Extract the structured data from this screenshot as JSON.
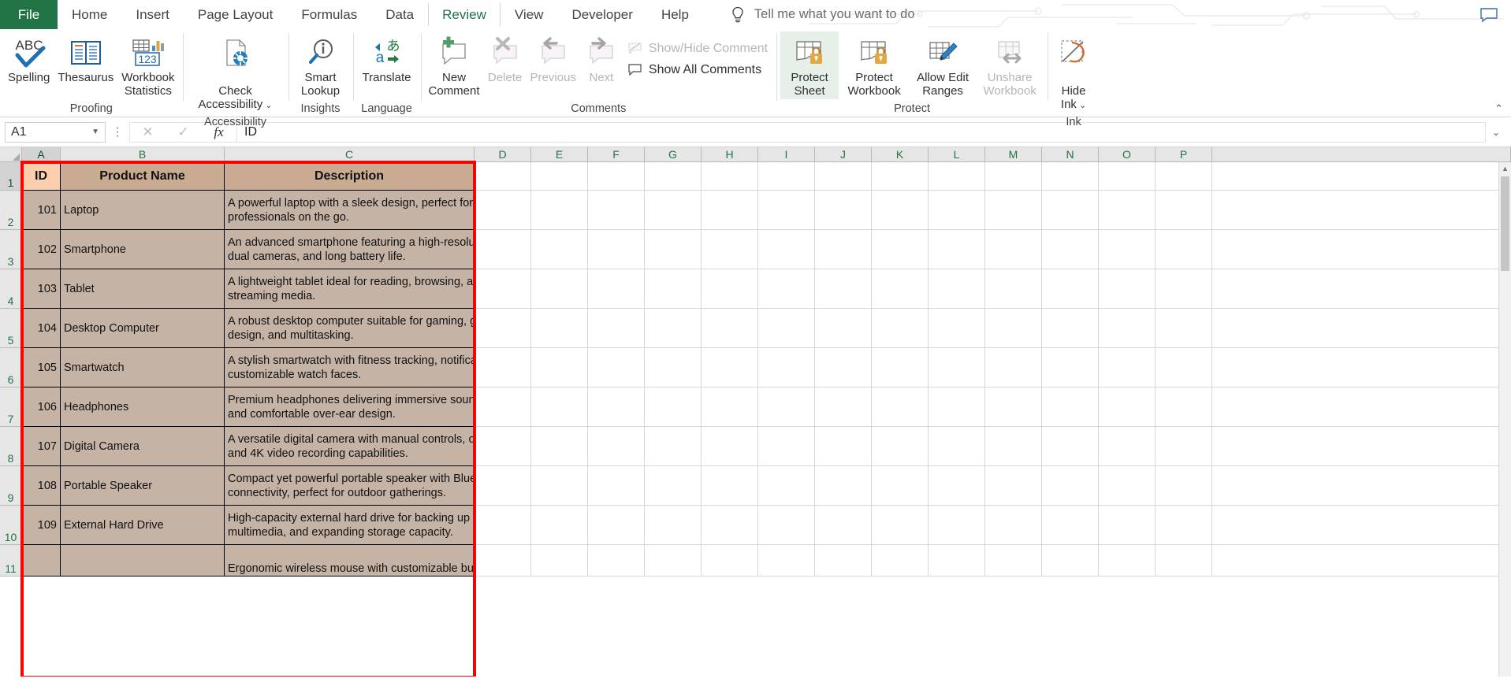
{
  "tabs": [
    {
      "label": "File",
      "active": false,
      "is_file": true
    },
    {
      "label": "Home",
      "active": false
    },
    {
      "label": "Insert",
      "active": false
    },
    {
      "label": "Page Layout",
      "active": false
    },
    {
      "label": "Formulas",
      "active": false
    },
    {
      "label": "Data",
      "active": false
    },
    {
      "label": "Review",
      "active": true
    },
    {
      "label": "View",
      "active": false
    },
    {
      "label": "Developer",
      "active": false
    },
    {
      "label": "Help",
      "active": false
    }
  ],
  "tell_me": {
    "placeholder": "Tell me what you want to do",
    "icon": "lightbulb-icon"
  },
  "ribbon": {
    "groups": [
      {
        "name": "Proofing",
        "label": "Proofing",
        "buttons": [
          {
            "label": "Spelling",
            "icon": "abc-check-icon",
            "disabled": false
          },
          {
            "label": "Thesaurus",
            "icon": "book-icon",
            "disabled": false
          },
          {
            "label": "Workbook\nStatistics",
            "icon": "workbook-stats-icon",
            "disabled": false
          }
        ]
      },
      {
        "name": "Accessibility",
        "label": "Accessibility",
        "buttons": [
          {
            "label": "Check\nAccessibility",
            "icon": "check-accessibility-icon",
            "disabled": false,
            "dropdown": true
          }
        ]
      },
      {
        "name": "Insights",
        "label": "Insights",
        "buttons": [
          {
            "label": "Smart\nLookup",
            "icon": "smart-lookup-icon",
            "disabled": false
          }
        ]
      },
      {
        "name": "Language",
        "label": "Language",
        "buttons": [
          {
            "label": "Translate",
            "icon": "translate-icon",
            "disabled": false
          }
        ]
      },
      {
        "name": "Comments",
        "label": "Comments",
        "buttons": [
          {
            "label": "New\nComment",
            "icon": "new-comment-icon",
            "disabled": false
          },
          {
            "label": "Delete",
            "icon": "delete-comment-icon",
            "disabled": true
          },
          {
            "label": "Previous",
            "icon": "previous-comment-icon",
            "disabled": true
          },
          {
            "label": "Next",
            "icon": "next-comment-icon",
            "disabled": true
          }
        ],
        "small_buttons": [
          {
            "label": "Show/Hide Comment",
            "icon": "show-hide-comment-icon",
            "disabled": true
          },
          {
            "label": "Show All Comments",
            "icon": "show-all-comments-icon",
            "disabled": false
          }
        ]
      },
      {
        "name": "Protect",
        "label": "Protect",
        "buttons": [
          {
            "label": "Protect\nSheet",
            "icon": "protect-sheet-icon",
            "disabled": false,
            "selected": true
          },
          {
            "label": "Protect\nWorkbook",
            "icon": "protect-workbook-icon",
            "disabled": false
          },
          {
            "label": "Allow Edit\nRanges",
            "icon": "allow-edit-ranges-icon",
            "disabled": false
          },
          {
            "label": "Unshare\nWorkbook",
            "icon": "unshare-workbook-icon",
            "disabled": true
          }
        ]
      },
      {
        "name": "Ink",
        "label": "Ink",
        "buttons": [
          {
            "label": "Hide\nInk",
            "icon": "hide-ink-icon",
            "disabled": false,
            "dropdown": true
          }
        ]
      }
    ],
    "collapse_icon": "chevron-up-icon"
  },
  "formula_bar": {
    "name_box_value": "A1",
    "name_box_icon": "chevron-down-icon",
    "cancel_icon": "cancel-icon",
    "enter_icon": "enter-icon",
    "function_icon": "fx-icon",
    "formula_value": "ID",
    "expand_icon": "chevron-down-icon"
  },
  "grid": {
    "column_headers": [
      "A",
      "B",
      "C",
      "D",
      "E",
      "F",
      "G",
      "H",
      "I",
      "J",
      "K",
      "L",
      "M",
      "N",
      "O",
      "P"
    ],
    "row_headers": [
      "1",
      "2",
      "3",
      "4",
      "5",
      "6",
      "7",
      "8",
      "9",
      "10",
      "11"
    ],
    "selected_column": "A",
    "selected_row": "1",
    "active_cell": "A1",
    "table_headers": [
      "ID",
      "Product Name",
      "Description"
    ],
    "rows": [
      {
        "id": "101",
        "product": "Laptop",
        "desc_lines": [
          "A powerful laptop with a sleek design, perfect for",
          "professionals on the go."
        ]
      },
      {
        "id": "102",
        "product": "Smartphone",
        "desc_lines": [
          "An advanced smartphone featuring a high-resolution screen,",
          "dual cameras, and long battery life."
        ]
      },
      {
        "id": "103",
        "product": "Tablet",
        "desc_lines": [
          "A lightweight tablet ideal for reading, browsing, and",
          "streaming media."
        ]
      },
      {
        "id": "104",
        "product": "Desktop Computer",
        "desc_lines": [
          "A robust desktop computer suitable for gaming, graphic",
          "design, and multitasking."
        ]
      },
      {
        "id": "105",
        "product": "Smartwatch",
        "desc_lines": [
          "A stylish smartwatch with fitness tracking, notifications, and",
          "customizable watch faces."
        ]
      },
      {
        "id": "106",
        "product": "Headphones",
        "desc_lines": [
          "Premium headphones delivering immersive sound quality",
          "and comfortable over-ear design."
        ]
      },
      {
        "id": "107",
        "product": "Digital Camera",
        "desc_lines": [
          "A versatile digital camera with manual controls, optical zoom,",
          "and 4K video recording capabilities."
        ]
      },
      {
        "id": "108",
        "product": "Portable Speaker",
        "desc_lines": [
          "Compact yet powerful portable speaker with Bluetooth",
          "connectivity, perfect for outdoor gatherings."
        ]
      },
      {
        "id": "109",
        "product": "External Hard Drive",
        "desc_lines": [
          "High-capacity external hard drive for backing up files, storing",
          "multimedia, and expanding storage capacity."
        ]
      },
      {
        "id": "",
        "product": "",
        "desc_lines": [
          "Ergonomic wireless mouse with customizable buttons and"
        ]
      }
    ]
  },
  "colors": {
    "brand_green": "#217346",
    "table_header_fill": "#c9ab92",
    "table_body_fill": "#c5b3a6",
    "active_cell_fill": "#fbcfad",
    "selection_border": "#ff0000"
  }
}
